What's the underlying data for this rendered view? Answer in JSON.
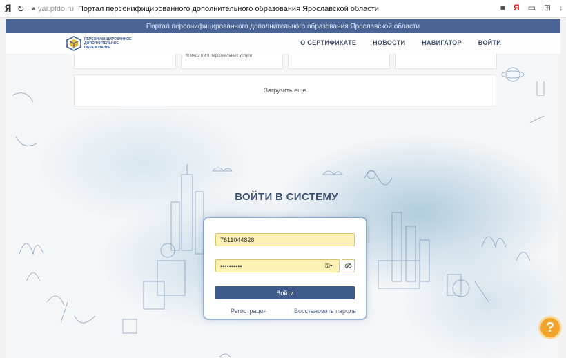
{
  "browser": {
    "yandex_logo": "Я",
    "domain": "yar.pfdo.ru",
    "tab_title": "Портал персонифицированного дополнительного образования Ярославской области",
    "right_yandex": "Я"
  },
  "site": {
    "top_title": "Портал персонифицированного дополнительного образования Ярославской области",
    "logo_text": "ПЕРСОНИФИЦИРОВАННОЕ ДОПОЛНИТЕЛЬНОЕ ОБРАЗОВАНИЕ",
    "nav": [
      {
        "label": "О СЕРТИФИКАТЕ"
      },
      {
        "label": "НОВОСТИ"
      },
      {
        "label": "НАВИГАТОР"
      },
      {
        "label": "ВОЙТИ"
      }
    ]
  },
  "cards": [
    {
      "text": ""
    },
    {
      "text": "Кличдэ гги в персональных услуги"
    },
    {
      "text": ""
    },
    {
      "text": ""
    }
  ],
  "load_more": "Загрузить еще",
  "login": {
    "heading": "ВОЙТИ В СИСТЕМУ",
    "login_value": "7611044828",
    "password_value": "••••••••••",
    "submit_label": "Войти",
    "register_label": "Регистрация",
    "restore_label": "Восстановить пароль"
  },
  "help": {
    "label": "?"
  },
  "colors": {
    "header_blue": "#4a6596",
    "button_blue": "#3d5a8a",
    "input_yellow": "#fdf1b5",
    "help_orange": "#f2a32c"
  }
}
